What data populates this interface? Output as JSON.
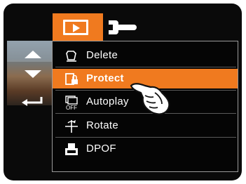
{
  "tabs": [
    {
      "icon": "playback-icon",
      "active": true
    },
    {
      "icon": "setup-wrench-icon",
      "active": false
    }
  ],
  "side_nav": {
    "up_icon": "up-arrow-icon",
    "down_icon": "down-arrow-icon",
    "back_icon": "return-arrow-icon"
  },
  "menu": {
    "items": [
      {
        "label": "Delete",
        "icon": "delete-icon"
      },
      {
        "label": "Protect",
        "icon": "protect-icon",
        "selected": true
      },
      {
        "label": "Autoplay",
        "icon": "autoplay-icon"
      },
      {
        "label": "Rotate",
        "icon": "rotate-icon"
      },
      {
        "label": "DPOF",
        "icon": "dpof-print-icon"
      }
    ],
    "autoplay_icon_text": "OFF"
  },
  "colors": {
    "accent": "#f07a1f",
    "background": "#0a0a0a",
    "text": "#ffffff",
    "border": "#9a9a9a"
  }
}
